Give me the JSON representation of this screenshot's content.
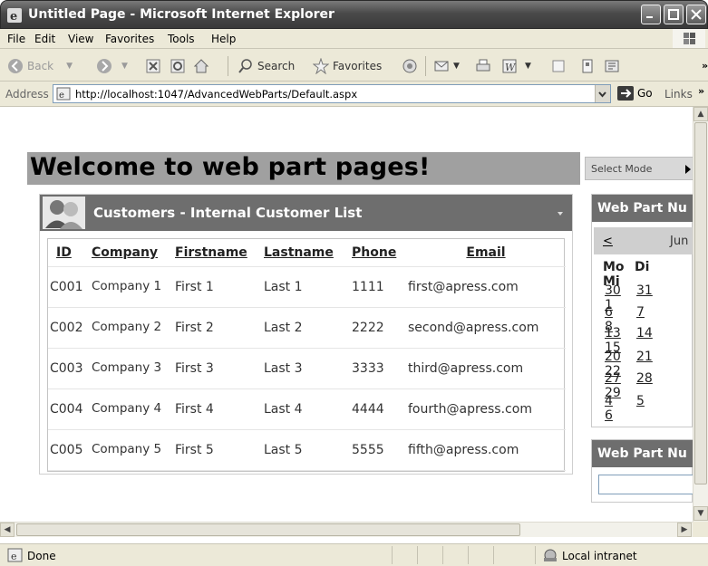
{
  "window": {
    "title": "Untitled Page - Microsoft Internet Explorer"
  },
  "menu": [
    "File",
    "Edit",
    "View",
    "Favorites",
    "Tools",
    "Help"
  ],
  "toolbar": {
    "back": "Back",
    "search": "Search",
    "favorites": "Favorites"
  },
  "address": {
    "label": "Address",
    "url": "http://localhost:1047/AdvancedWebParts/Default.aspx",
    "go": "Go",
    "links": "Links"
  },
  "page": {
    "heading": "Welcome to web part pages!",
    "select_mode": "Select Mode"
  },
  "customers_part": {
    "title": "Customers - Internal Customer List",
    "columns": [
      "ID",
      "Company",
      "Firstname",
      "Lastname",
      "Phone",
      "Email"
    ],
    "rows": [
      {
        "id": "C001",
        "company": "Company 1",
        "firstname": "First 1",
        "lastname": "Last 1",
        "phone": "1111",
        "email": "first@apress.com"
      },
      {
        "id": "C002",
        "company": "Company 2",
        "firstname": "First 2",
        "lastname": "Last 2",
        "phone": "2222",
        "email": "second@apress.com"
      },
      {
        "id": "C003",
        "company": "Company 3",
        "firstname": "First 3",
        "lastname": "Last 3",
        "phone": "3333",
        "email": "third@apress.com"
      },
      {
        "id": "C004",
        "company": "Company 4",
        "firstname": "First 4",
        "lastname": "Last 4",
        "phone": "4444",
        "email": "fourth@apress.com"
      },
      {
        "id": "C005",
        "company": "Company 5",
        "firstname": "First 5",
        "lastname": "Last 5",
        "phone": "5555",
        "email": "fifth@apress.com"
      }
    ]
  },
  "calendar_part": {
    "title": "Web Part Nu",
    "prev": "<",
    "month": "Jun",
    "day_headers": [
      "Mo",
      "Di",
      "Mi"
    ],
    "weeks": [
      [
        "30",
        "31",
        "1"
      ],
      [
        "6",
        "7",
        "8"
      ],
      [
        "13",
        "14",
        "15"
      ],
      [
        "20",
        "21",
        "22"
      ],
      [
        "27",
        "28",
        "29"
      ],
      [
        "4",
        "5",
        "6"
      ]
    ]
  },
  "second_part": {
    "title": "Web Part Nu"
  },
  "status": {
    "text": "Done",
    "zone": "Local intranet"
  }
}
